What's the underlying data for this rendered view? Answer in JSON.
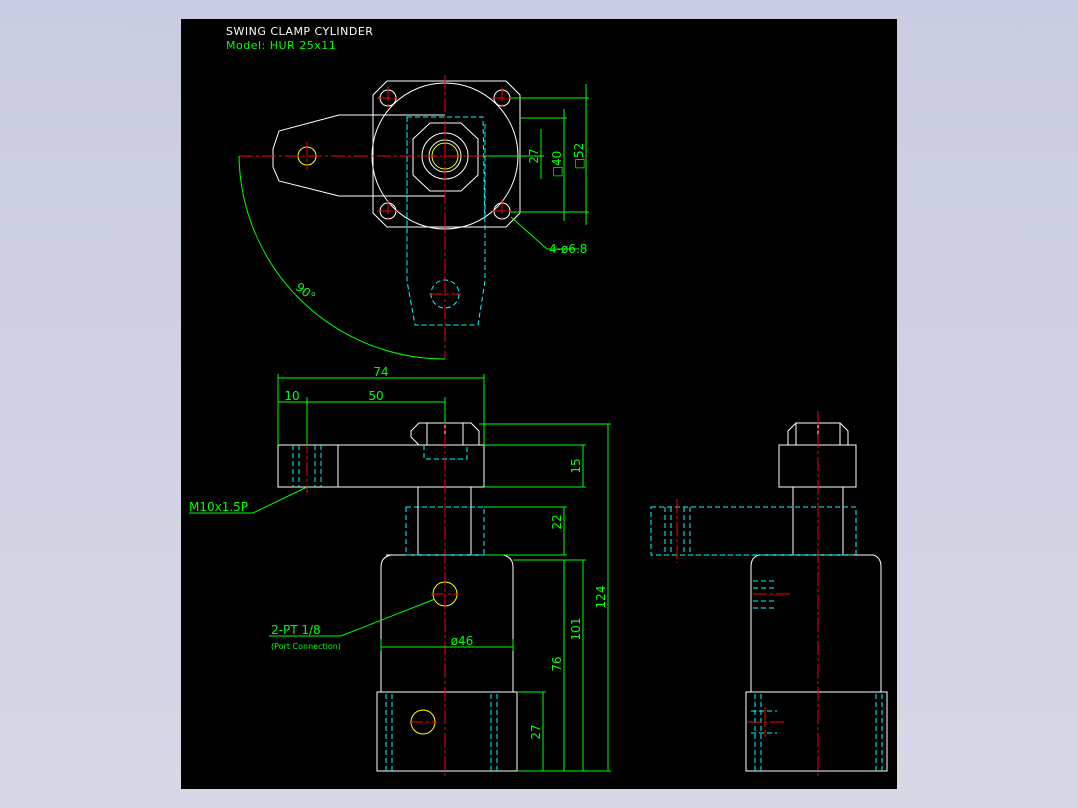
{
  "title": "SWING CLAMP CYLINDER",
  "model": "Model: HUR 25x11",
  "colors": {
    "background": "#000000",
    "outline": "#ffffff",
    "hidden": "#00ffff",
    "center": "#ff0000",
    "dimension": "#00ff00",
    "hole": "#ffff00",
    "title": "#ffffff",
    "subtitle": "#00ff00"
  },
  "top_view": {
    "square_40": "□40",
    "square_52": "□52",
    "dim_27": "27",
    "holes_note": "4-ø6.8",
    "angle": "90°"
  },
  "front_view": {
    "width_74": "74",
    "offset_10": "10",
    "reach_50": "50",
    "height_15": "15",
    "stroke_22": "22",
    "body_101": "101",
    "overall_124": "124",
    "base_76": "76",
    "flange_27": "27",
    "diameter_46": "ø46",
    "thread_note": "M10x1.5P",
    "port_note": "2-PT 1/8",
    "port_sub": "(Port Connection)"
  }
}
